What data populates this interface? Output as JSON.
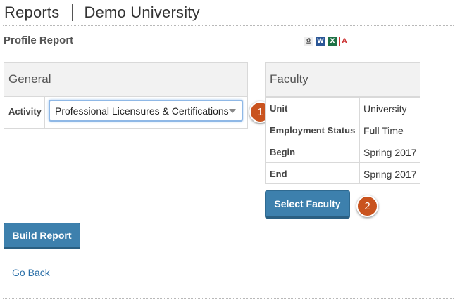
{
  "header": {
    "app_title": "Reports",
    "org_title": "Demo University"
  },
  "report": {
    "title": "Profile Report"
  },
  "export_icons": [
    {
      "name": "print-icon",
      "glyph": "⎙"
    },
    {
      "name": "word-icon",
      "glyph": "W"
    },
    {
      "name": "excel-icon",
      "glyph": "X"
    },
    {
      "name": "pdf-icon",
      "glyph": "A"
    }
  ],
  "general": {
    "heading": "General",
    "activity_label": "Activity",
    "activity_value": "Professional Licensures & Certifications"
  },
  "faculty": {
    "heading": "Faculty",
    "rows": [
      {
        "label": "Unit",
        "value": "University"
      },
      {
        "label": "Employment Status",
        "value": "Full Time"
      },
      {
        "label": "Begin",
        "value": "Spring 2017"
      },
      {
        "label": "End",
        "value": "Spring 2017"
      }
    ]
  },
  "buttons": {
    "select_faculty": "Select Faculty",
    "build_report": "Build Report"
  },
  "links": {
    "go_back": "Go Back"
  },
  "callouts": [
    "1",
    "2"
  ],
  "colors": {
    "button": "#3d80ad",
    "callout": "#c9531e",
    "link": "#2a6fa8"
  }
}
